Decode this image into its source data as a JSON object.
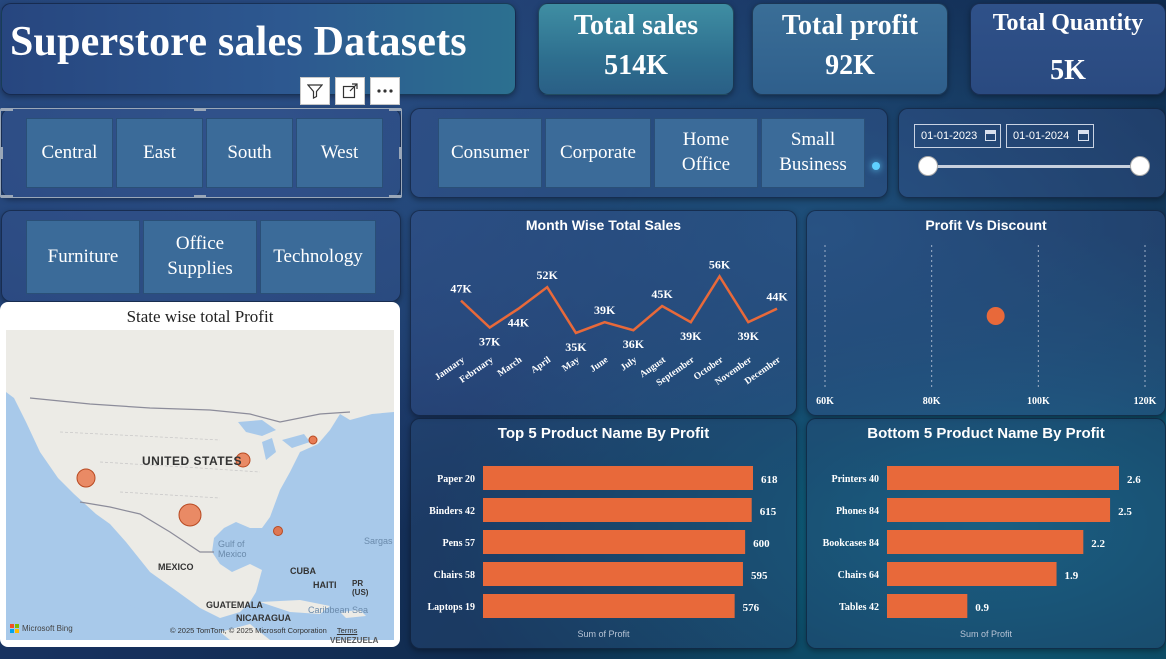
{
  "header": {
    "title": "Superstore sales Datasets"
  },
  "kpis": {
    "sales": {
      "label": "Total sales",
      "value": "514K"
    },
    "profit": {
      "label": "Total profit",
      "value": "92K"
    },
    "quantity": {
      "label": "Total Quantity",
      "value": "5K"
    }
  },
  "region_slicer": [
    "Central",
    "East",
    "South",
    "West"
  ],
  "segment_slicer": [
    "Consumer",
    "Corporate",
    "Home\nOffice",
    "Small\nBusiness"
  ],
  "category_slicer": [
    "Furniture",
    "Office\nSupplies",
    "Technology"
  ],
  "date_slicer": {
    "start": "01-01-2023",
    "end": "01-01-2024"
  },
  "toolbar": {
    "filter_icon": "funnel-icon",
    "focus_icon": "expand-icon",
    "more_icon": "ellipsis-icon"
  },
  "map": {
    "title": "State wise total Profit",
    "labels": {
      "country": "UNITED STATES",
      "gulf": "Gulf of\nMexico",
      "mexico": "MEXICO",
      "cuba": "CUBA",
      "haiti": "HAITI",
      "pr": "PR\n(US)",
      "guatemala": "GUATEMALA",
      "nicaragua": "NICARAGUA",
      "caribbean": "Caribbean Sea",
      "sargasso": "Sargas",
      "venezuela": "VENEZUELA"
    },
    "logo": "Microsoft Bing",
    "copyright": "© 2025 TomTom, © 2025 Microsoft Corporation",
    "terms": "Terms"
  },
  "colors": {
    "accent": "#e8693a",
    "panel": "#2c4f88"
  },
  "chart_data": [
    {
      "id": "month",
      "type": "line",
      "title": "Month Wise Total Sales",
      "categories": [
        "January",
        "February",
        "March",
        "April",
        "May",
        "June",
        "July",
        "August",
        "September",
        "October",
        "November",
        "December"
      ],
      "values": [
        47,
        37,
        44,
        52,
        35,
        39,
        36,
        45,
        39,
        56,
        39,
        44
      ],
      "labels": [
        "47K",
        "37K",
        "44K",
        "52K",
        "35K",
        "39K",
        "36K",
        "45K",
        "39K",
        "56K",
        "39K",
        "44K"
      ],
      "color": "#e8693a"
    },
    {
      "id": "scatter",
      "type": "scatter",
      "title": "Profit Vs Discount",
      "x_ticks": [
        "60K",
        "80K",
        "100K",
        "120K"
      ],
      "x_range": [
        60,
        120
      ],
      "points": [
        {
          "x": 92,
          "y": 0.5
        }
      ],
      "color": "#e8693a"
    },
    {
      "id": "top5",
      "type": "bar",
      "title": "Top 5 Product Name By Profit",
      "categories": [
        "Paper 20",
        "Binders 42",
        "Pens 57",
        "Chairs 58",
        "Laptops 19"
      ],
      "values": [
        618,
        615,
        600,
        595,
        576
      ],
      "value_labels": [
        "618",
        "615",
        "600",
        "595",
        "576"
      ],
      "xlabel": "Sum of Profit",
      "color": "#e8693a"
    },
    {
      "id": "bottom5",
      "type": "bar",
      "title": "Bottom 5 Product Name By Profit",
      "categories": [
        "Printers 40",
        "Phones 84",
        "Bookcases 84",
        "Chairs 64",
        "Tables 42"
      ],
      "values": [
        2.6,
        2.5,
        2.2,
        1.9,
        0.9
      ],
      "value_labels": [
        "2.6",
        "2.5",
        "2.2",
        "1.9",
        "0.9"
      ],
      "xlabel": "Sum of Profit",
      "color": "#e8693a"
    }
  ]
}
